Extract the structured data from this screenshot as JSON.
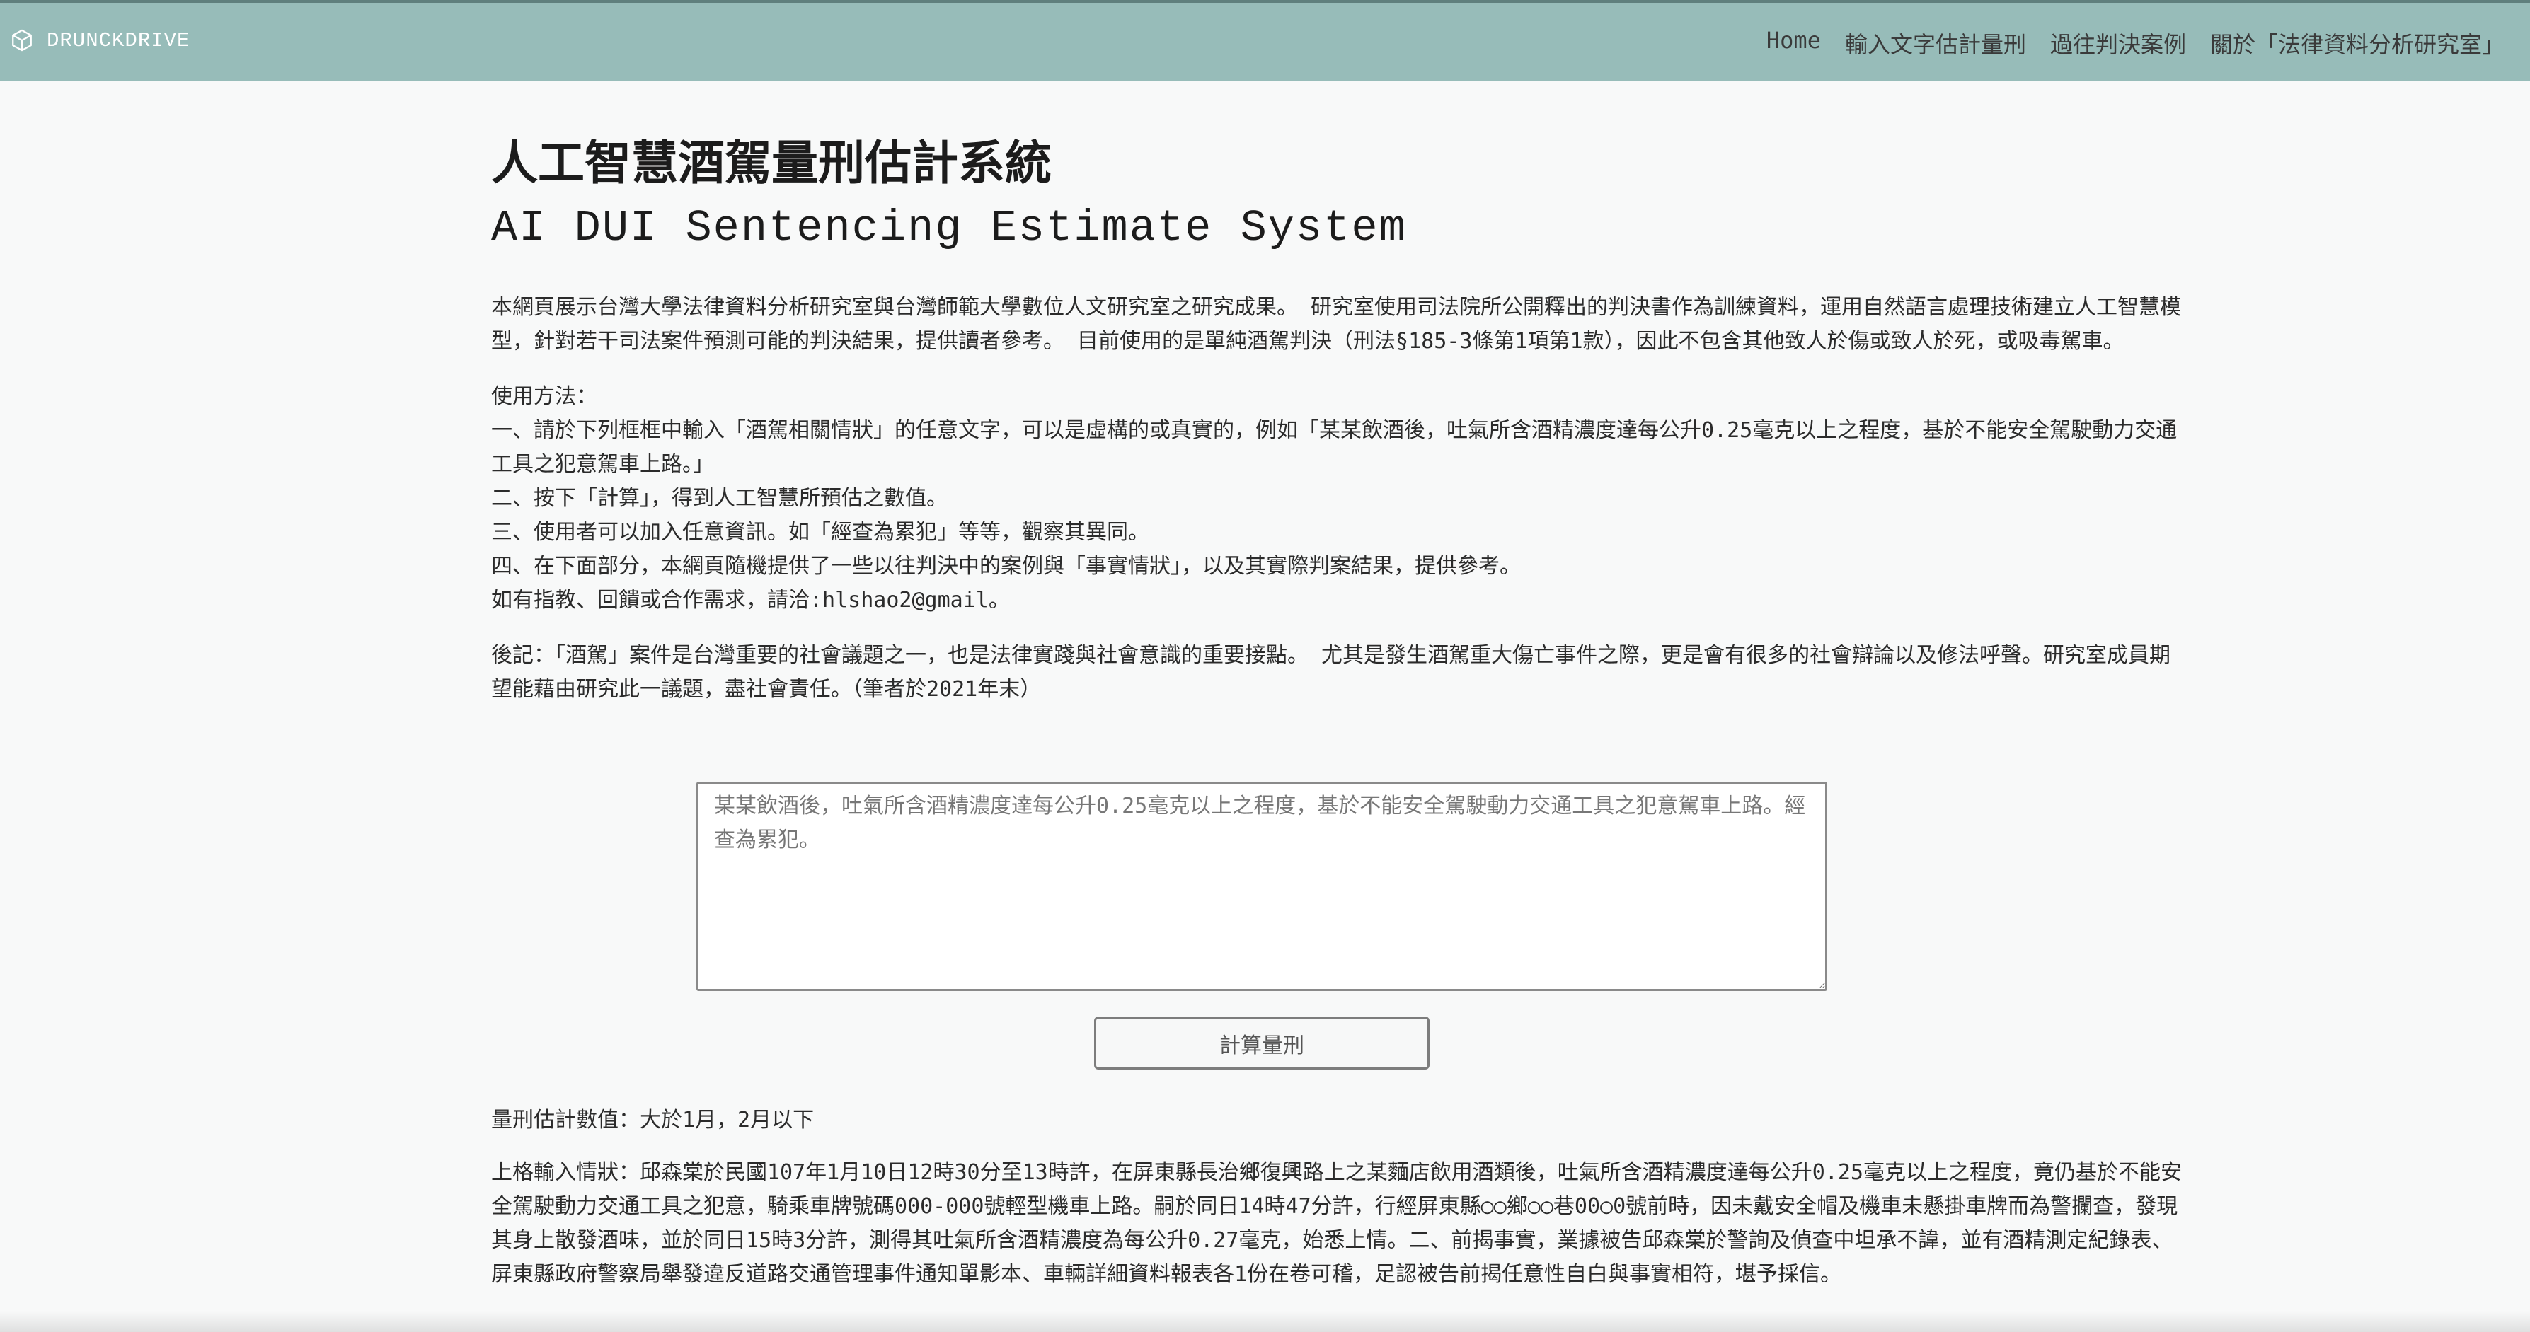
{
  "navbar": {
    "brand": "DRUNCKDRIVE",
    "links": [
      "Home",
      "輸入文字估計量刑",
      "過往判決案例",
      "關於「法律資料分析研究室」"
    ],
    "background": "#97bcb9"
  },
  "header": {
    "title_zh": "人工智慧酒駕量刑估計系統",
    "title_en": "AI DUI Sentencing Estimate System"
  },
  "intro": "本網頁展示台灣大學法律資料分析研究室與台灣師範大學數位人文研究室之研究成果。 研究室使用司法院所公開釋出的判決書作為訓練資料，運用自然語言處理技術建立人工智慧模型，針對若干司法案件預測可能的判決結果，提供讀者參考。 目前使用的是單純酒駕判決（刑法§185-3條第1項第1款），因此不包含其他致人於傷或致人於死，或吸毒駕車。",
  "usage": {
    "heading": "使用方法：",
    "steps": [
      "一、請於下列框框中輸入「酒駕相關情狀」的任意文字，可以是虛構的或真實的，例如「某某飲酒後，吐氣所含酒精濃度達每公升0.25毫克以上之程度，基於不能安全駕駛動力交通工具之犯意駕車上路。」",
      "二、按下「計算」，得到人工智慧所預估之數值。",
      "三、使用者可以加入任意資訊。如「經查為累犯」等等，觀察其異同。",
      "四、在下面部分，本網頁隨機提供了一些以往判決中的案例與「事實情狀」，以及其實際判案結果，提供參考。"
    ],
    "contact": "如有指教、回饋或合作需求，請洽:hlshao2@gmail。"
  },
  "postscript": "後記：「酒駕」案件是台灣重要的社會議題之一，也是法律實踐與社會意識的重要接點。 尤其是發生酒駕重大傷亡事件之際，更是會有很多的社會辯論以及修法呼聲。研究室成員期望能藉由研究此一議題，盡社會責任。（筆者於2021年末）",
  "input": {
    "placeholder": "某某飲酒後，吐氣所含酒精濃度達每公升0.25毫克以上之程度，基於不能安全駕駛動力交通工具之犯意駕車上路。經查為累犯。"
  },
  "button": {
    "label": "計算量刑"
  },
  "result": {
    "estimate": "量刑估計數值：大於1月，2月以下",
    "case_text": "上格輸入情狀：邱森棠於民國107年1月10日12時30分至13時許，在屏東縣長治鄉復興路上之某麵店飲用酒類後，吐氣所含酒精濃度達每公升0.25毫克以上之程度，竟仍基於不能安全駕駛動力交通工具之犯意，騎乘車牌號碼000-000號輕型機車上路。嗣於同日14時47分許，行經屏東縣○○鄉○○巷00○0號前時，因未戴安全帽及機車未懸掛車牌而為警攔查，發現其身上散發酒味，並於同日15時3分許，測得其吐氣所含酒精濃度為每公升0.27毫克，始悉上情。二、前揭事實，業據被告邱森棠於警詢及偵查中坦承不諱，並有酒精測定紀錄表、屏東縣政府警察局舉發違反道路交通管理事件通知單影本、車輛詳細資料報表各1份在卷可稽，足認被告前揭任意性自白與事實相符，堪予採信。"
  }
}
